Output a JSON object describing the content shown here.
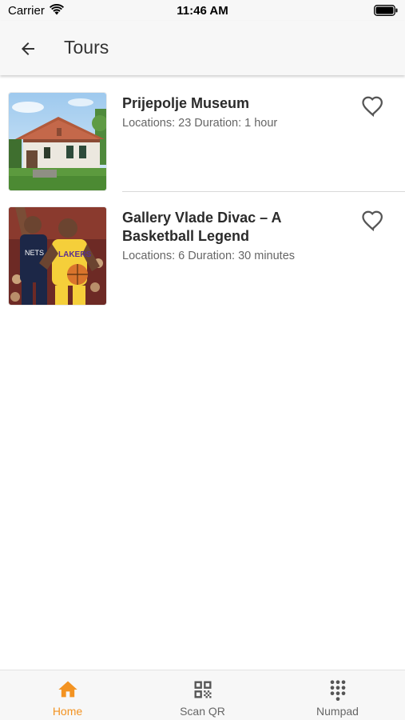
{
  "status_bar": {
    "carrier": "Carrier",
    "time": "11:46 AM"
  },
  "header": {
    "title": "Tours"
  },
  "tours": [
    {
      "name": "Prijepolje Museum",
      "meta": "Locations: 23 Duration: 1 hour",
      "image": "house-photo"
    },
    {
      "name": "Gallery Vlade Divac – A Basketball Legend",
      "meta": "Locations: 6 Duration: 30 minutes",
      "image": "basketball-photo"
    }
  ],
  "tab_bar": {
    "tabs": [
      {
        "label": "Home",
        "icon": "home-icon",
        "active": true
      },
      {
        "label": "Scan QR",
        "icon": "qr-code-icon",
        "active": false
      },
      {
        "label": "Numpad",
        "icon": "numpad-icon",
        "active": false
      }
    ]
  },
  "colors": {
    "accent": "#f39322",
    "bar_bg": "#f7f7f7",
    "icon_gray": "#555555"
  }
}
